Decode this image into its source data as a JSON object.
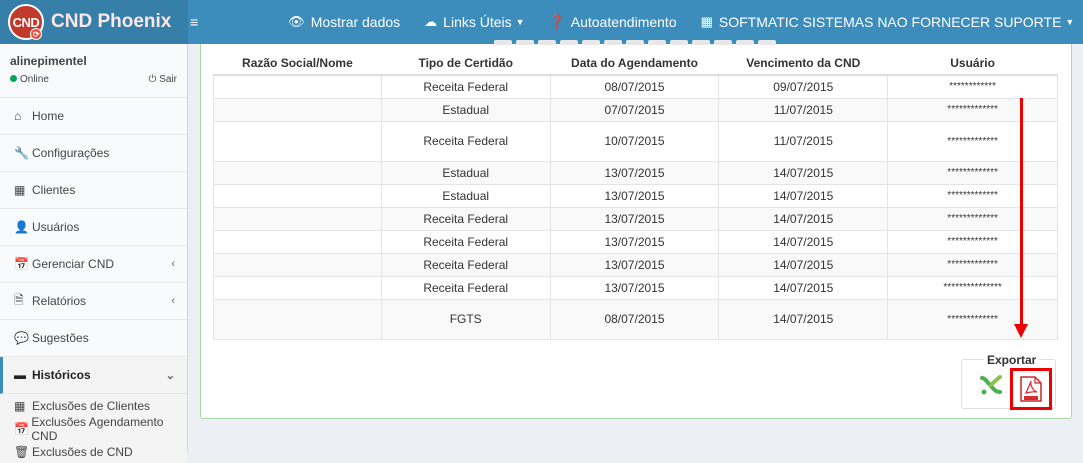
{
  "logo": {
    "badge": "CND",
    "title": "CND Phoenix"
  },
  "topnav": {
    "menu_icon": "hamburger-icon",
    "items": [
      {
        "label": "Mostrar dados",
        "icon": "eye-icon"
      },
      {
        "label": "Links Úteis",
        "icon": "cloud-icon"
      },
      {
        "label": "Autoatendimento",
        "icon": "question-circle-icon"
      },
      {
        "label": "SOFTMATIC SISTEMAS NAO FORNECER SUPORTE",
        "icon": "building-icon"
      }
    ]
  },
  "user": {
    "name": "alinepimentel",
    "status": "Online",
    "logout": "Sair"
  },
  "sidebar": {
    "items": [
      {
        "label": "Home",
        "icon": "home-icon"
      },
      {
        "label": "Configurações",
        "icon": "wrench-icon"
      },
      {
        "label": "Clientes",
        "icon": "building-icon"
      },
      {
        "label": "Usuários",
        "icon": "user-icon"
      },
      {
        "label": "Gerenciar CND",
        "icon": "calendar-icon"
      },
      {
        "label": "Relatórios",
        "icon": "file-icon"
      },
      {
        "label": "Sugestões",
        "icon": "comments-icon"
      },
      {
        "label": "Históricos",
        "icon": "archive-icon"
      }
    ],
    "subitems": [
      {
        "label": "Exclusões de Clientes",
        "icon": "building-icon"
      },
      {
        "label": "Exclusões Agendamento CND",
        "icon": "calendar-icon"
      },
      {
        "label": "Exclusões de CND",
        "icon": "trash-icon"
      }
    ]
  },
  "table": {
    "headers": [
      "Razão Social/Nome",
      "Tipo de Certidão",
      "Data do Agendamento",
      "Vencimento da CND",
      "Usuário"
    ],
    "rows": [
      [
        "",
        "Receita Federal",
        "08/07/2015",
        "09/07/2015",
        "************"
      ],
      [
        "",
        "Estadual",
        "07/07/2015",
        "11/07/2015",
        "*************"
      ],
      [
        "",
        "Receita Federal",
        "10/07/2015",
        "11/07/2015",
        "*************"
      ],
      [
        "",
        "Estadual",
        "13/07/2015",
        "14/07/2015",
        "*************"
      ],
      [
        "",
        "Estadual",
        "13/07/2015",
        "14/07/2015",
        "*************"
      ],
      [
        "",
        "Receita Federal",
        "13/07/2015",
        "14/07/2015",
        "*************"
      ],
      [
        "",
        "Receita Federal",
        "13/07/2015",
        "14/07/2015",
        "*************"
      ],
      [
        "",
        "Receita Federal",
        "13/07/2015",
        "14/07/2015",
        "*************"
      ],
      [
        "",
        "Receita Federal",
        "13/07/2015",
        "14/07/2015",
        "***************"
      ],
      [
        "",
        "FGTS",
        "08/07/2015",
        "14/07/2015",
        "*************"
      ]
    ]
  },
  "export": {
    "label": "Exportar",
    "xls_icon": "excel-icon",
    "pdf_icon": "pdf-icon"
  },
  "colors": {
    "header": "#3c8dbc",
    "logo_bg": "#367fa9",
    "highlight": "#ee0000",
    "box_border": "#a9d9a7"
  }
}
